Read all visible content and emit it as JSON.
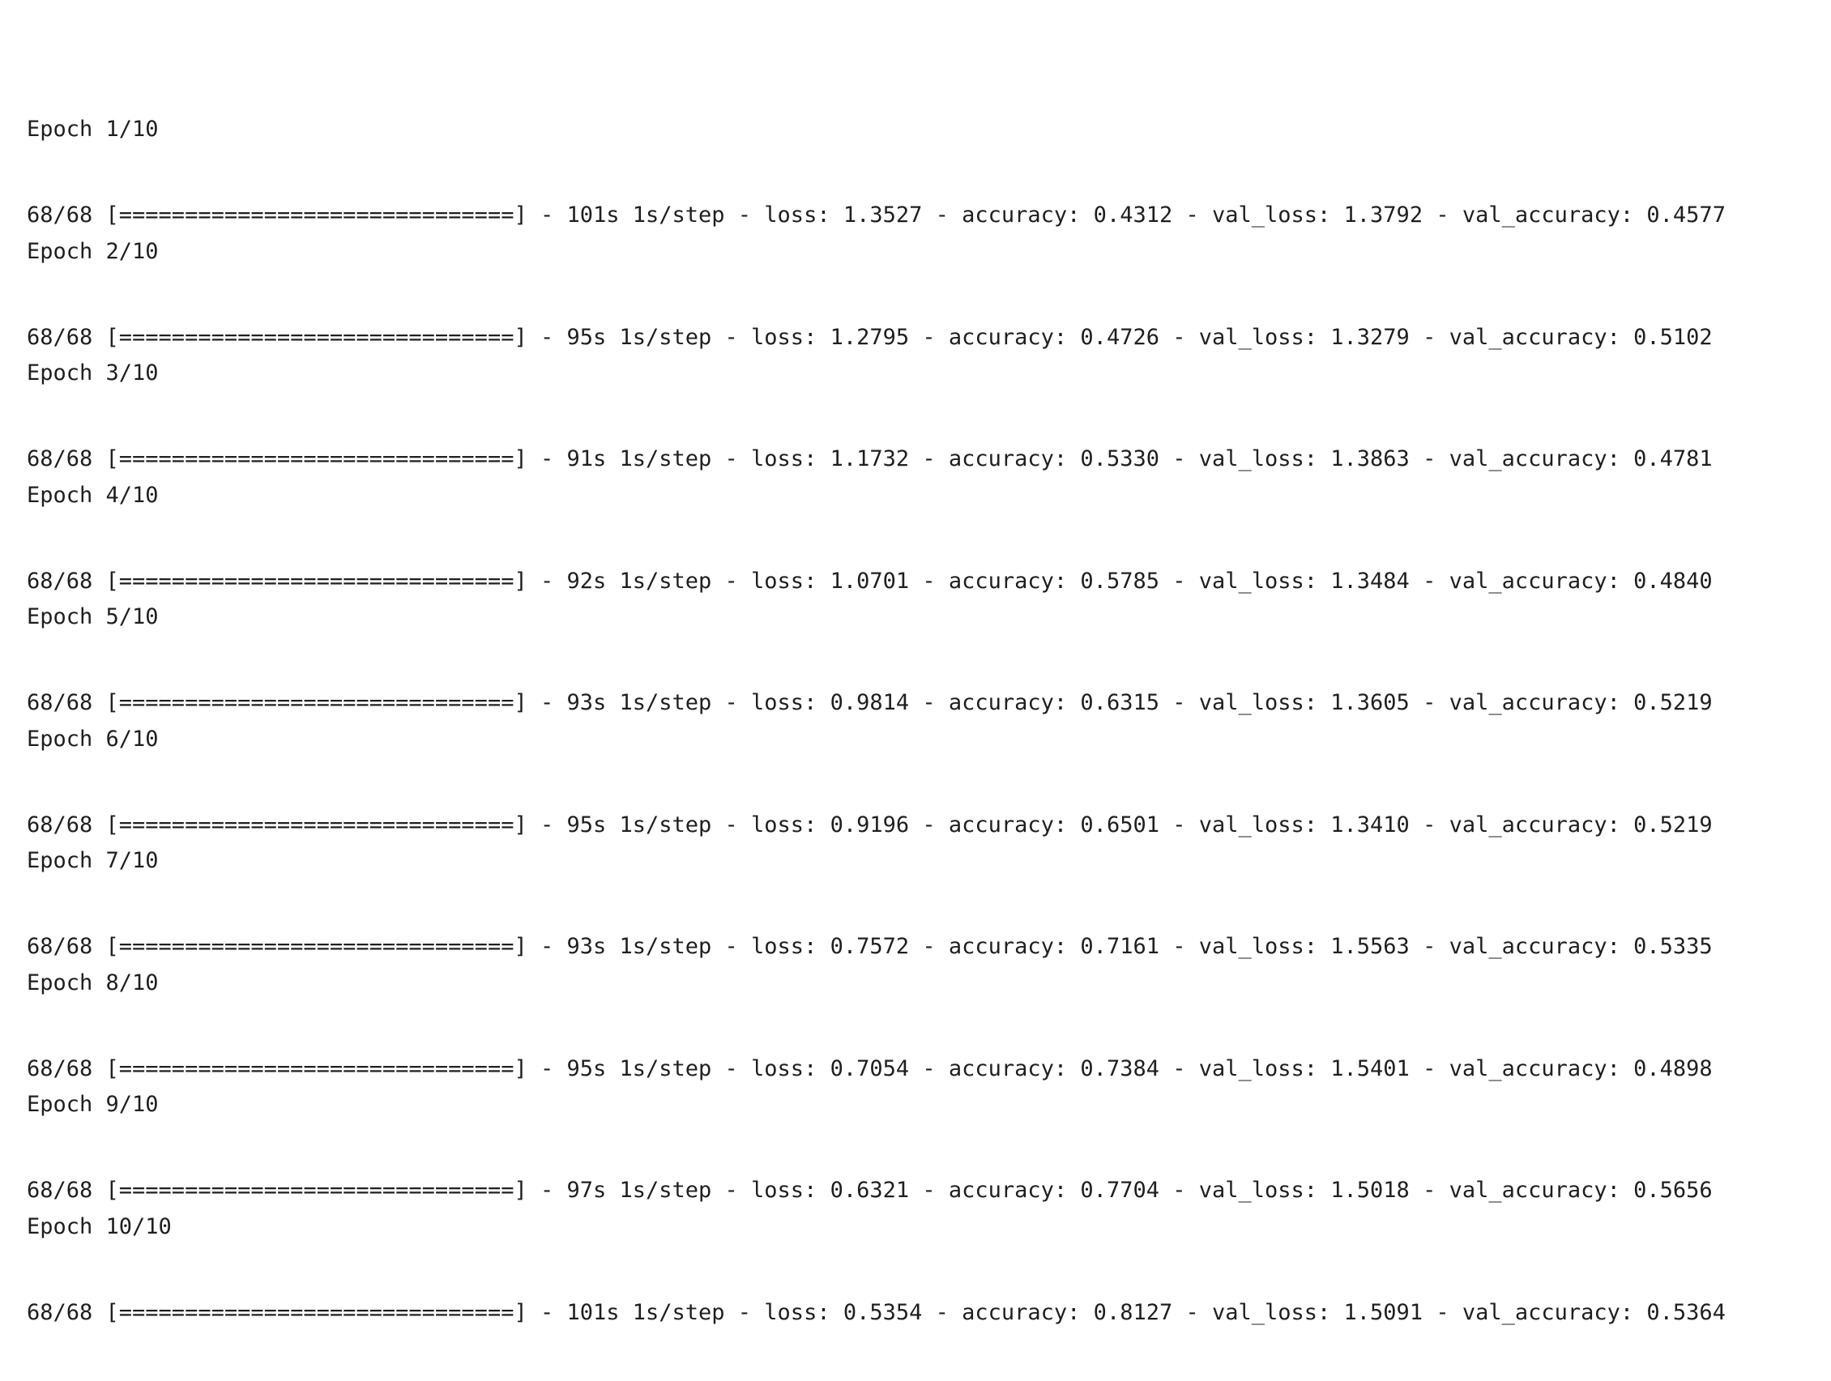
{
  "console": {
    "epochs": [
      {
        "header": "Epoch 1/10",
        "line": "68/68 [==============================] - 101s 1s/step - loss: 1.3527 - accuracy: 0.4312 - val_loss: 1.3792 - val_accuracy: 0.4577"
      },
      {
        "header": "Epoch 2/10",
        "line": "68/68 [==============================] - 95s 1s/step - loss: 1.2795 - accuracy: 0.4726 - val_loss: 1.3279 - val_accuracy: 0.5102"
      },
      {
        "header": "Epoch 3/10",
        "line": "68/68 [==============================] - 91s 1s/step - loss: 1.1732 - accuracy: 0.5330 - val_loss: 1.3863 - val_accuracy: 0.4781"
      },
      {
        "header": "Epoch 4/10",
        "line": "68/68 [==============================] - 92s 1s/step - loss: 1.0701 - accuracy: 0.5785 - val_loss: 1.3484 - val_accuracy: 0.4840"
      },
      {
        "header": "Epoch 5/10",
        "line": "68/68 [==============================] - 93s 1s/step - loss: 0.9814 - accuracy: 0.6315 - val_loss: 1.3605 - val_accuracy: 0.5219"
      },
      {
        "header": "Epoch 6/10",
        "line": "68/68 [==============================] - 95s 1s/step - loss: 0.9196 - accuracy: 0.6501 - val_loss: 1.3410 - val_accuracy: 0.5219"
      },
      {
        "header": "Epoch 7/10",
        "line": "68/68 [==============================] - 93s 1s/step - loss: 0.7572 - accuracy: 0.7161 - val_loss: 1.5563 - val_accuracy: 0.5335"
      },
      {
        "header": "Epoch 8/10",
        "line": "68/68 [==============================] - 95s 1s/step - loss: 0.7054 - accuracy: 0.7384 - val_loss: 1.5401 - val_accuracy: 0.4898"
      },
      {
        "header": "Epoch 9/10",
        "line": "68/68 [==============================] - 97s 1s/step - loss: 0.6321 - accuracy: 0.7704 - val_loss: 1.5018 - val_accuracy: 0.5656"
      },
      {
        "header": "Epoch 10/10",
        "line": "68/68 [==============================] - 101s 1s/step - loss: 0.5354 - accuracy: 0.8127 - val_loss: 1.5091 - val_accuracy: 0.5364"
      }
    ]
  }
}
